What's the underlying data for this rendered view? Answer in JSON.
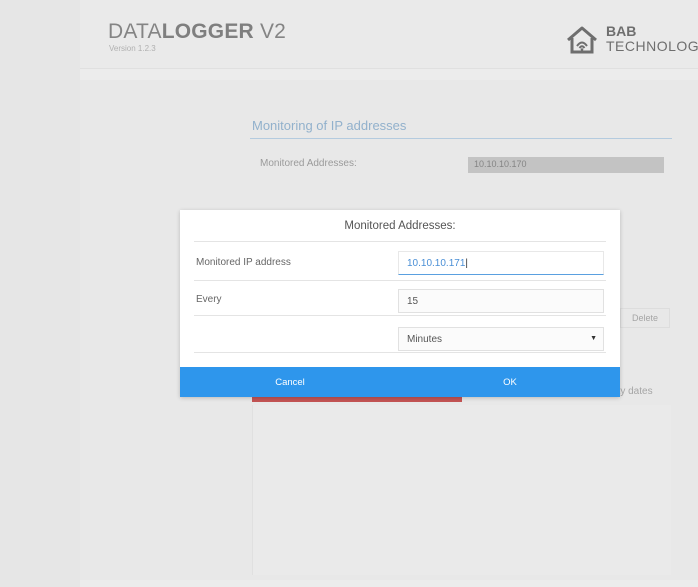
{
  "header": {
    "app_title_light": "DATA",
    "app_title_bold": "LOGGER",
    "app_title_suffix": " V2",
    "version": "Version 1.2.3",
    "brand_line1": "BAB",
    "brand_line2": "TECHNOLOGI"
  },
  "background": {
    "section_title": "Monitoring of IP addresses",
    "monitored_label": "Monitored Addresses:",
    "monitored_value": "10.10.10.170",
    "delete_label": "Delete",
    "dates_partial": "oty dates"
  },
  "dialog": {
    "title": "Monitored Addresses:",
    "ip_label": "Monitored IP address",
    "ip_value": "10.10.10.171",
    "every_label": "Every",
    "every_value": "15",
    "unit_selected": "Minutes",
    "cancel_label": "Cancel",
    "ok_label": "OK"
  },
  "colors": {
    "accent": "#2e96ec",
    "section_title": "#6a9ac4",
    "danger_bar": "#b70c0c"
  },
  "icons": {
    "brand_logo": "house-wifi-icon",
    "select_arrow": "triangle-down-icon"
  }
}
